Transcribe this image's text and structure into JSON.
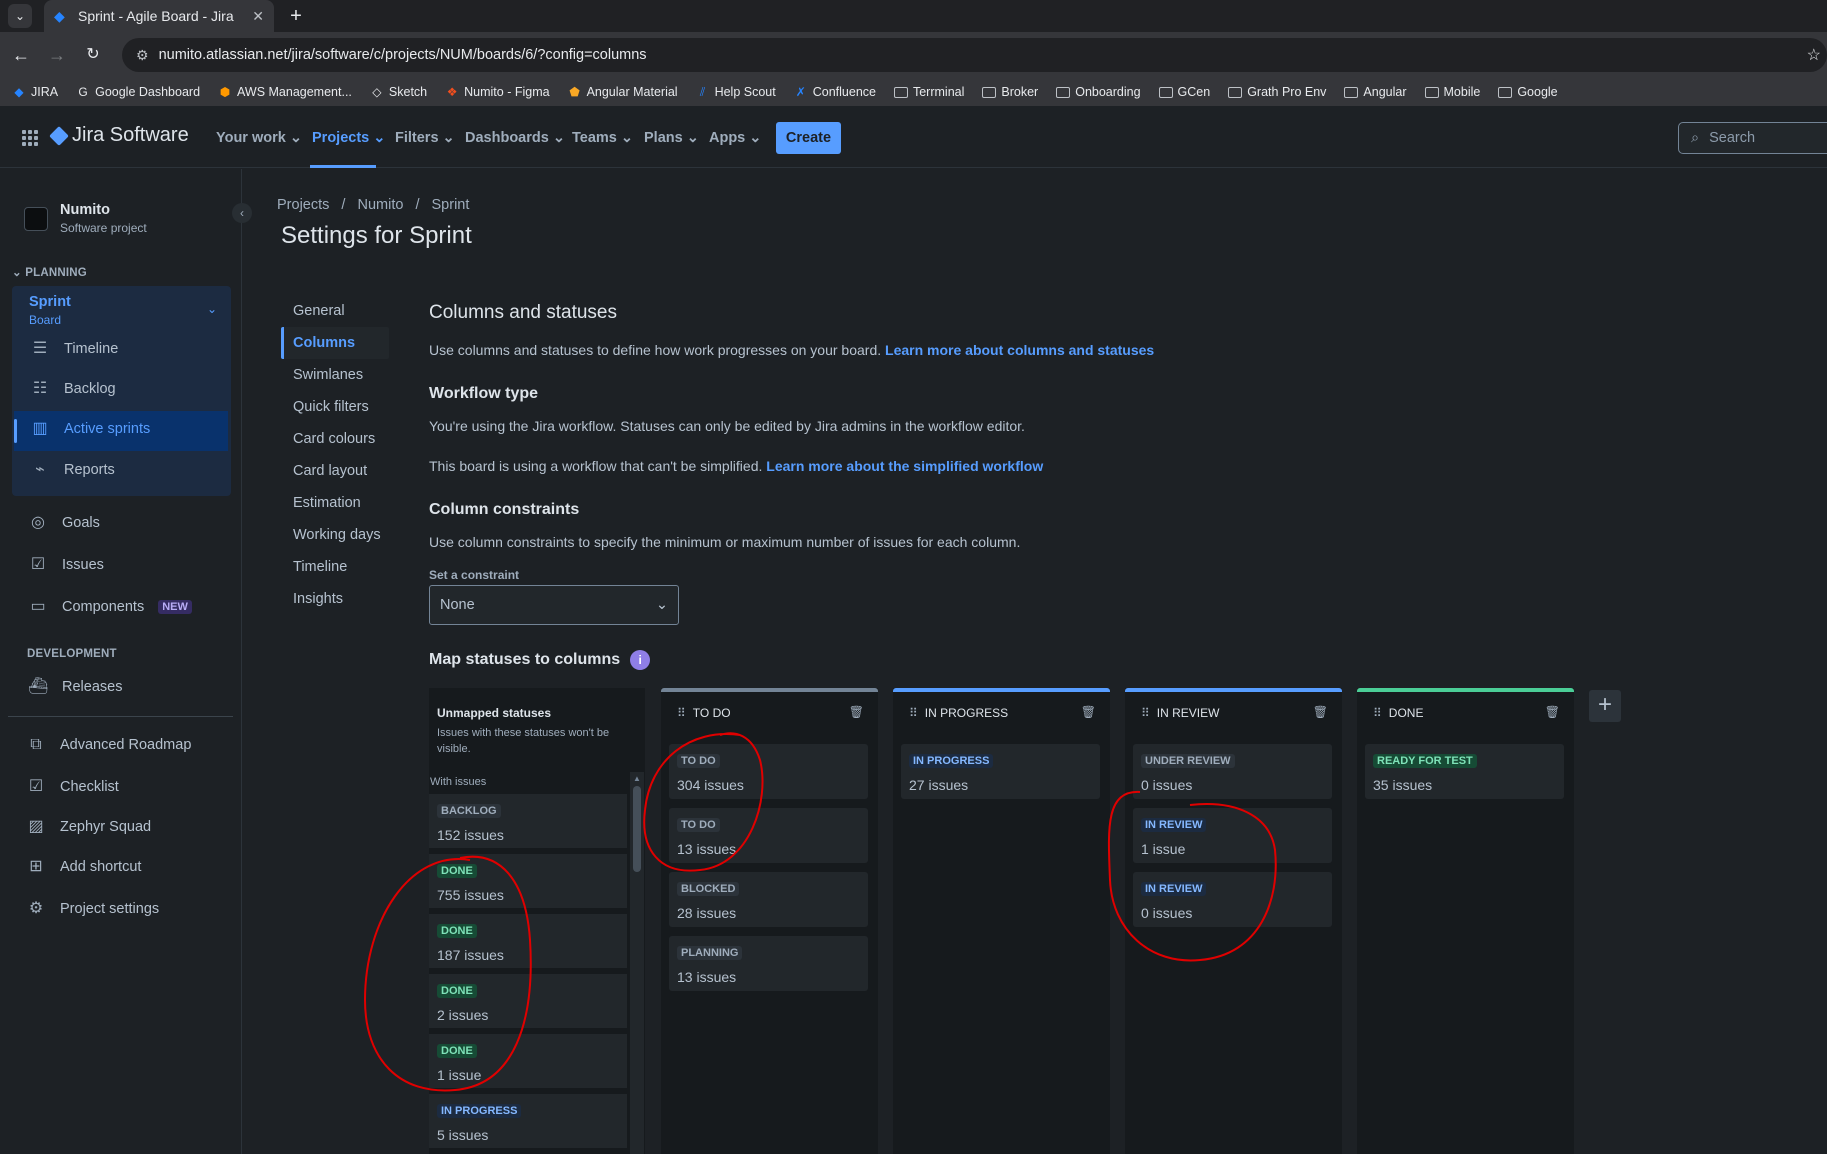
{
  "browser": {
    "tab_title": "Sprint - Agile Board - Jira",
    "url": "numito.atlassian.net/jira/software/c/projects/NUM/boards/6/?config=columns",
    "bookmarks": [
      "JIRA",
      "Google Dashboard",
      "AWS Management...",
      "Sketch",
      "Numito - Figma",
      "Angular Material",
      "Help Scout",
      "Confluence",
      "Terrminal",
      "Broker",
      "Onboarding",
      "GCen",
      "Grath Pro Env",
      "Angular",
      "Mobile",
      "Google"
    ]
  },
  "topnav": {
    "product": "Jira Software",
    "items": [
      "Your work",
      "Projects",
      "Filters",
      "Dashboards",
      "Teams",
      "Plans",
      "Apps"
    ],
    "create": "Create",
    "search_placeholder": "Search"
  },
  "sidebar": {
    "project_name": "Numito",
    "project_type": "Software project",
    "planning_label": "PLANNING",
    "sprint_title": "Sprint",
    "sprint_sub": "Board",
    "sprint_items": [
      "Timeline",
      "Backlog",
      "Active sprints",
      "Reports"
    ],
    "items": [
      "Goals",
      "Issues",
      "Components"
    ],
    "new_badge": "NEW",
    "development_label": "DEVELOPMENT",
    "releases": "Releases",
    "bottom_items": [
      "Advanced Roadmap",
      "Checklist",
      "Zephyr Squad",
      "Add shortcut",
      "Project settings"
    ]
  },
  "main": {
    "breadcrumb": [
      "Projects",
      "Numito",
      "Sprint"
    ],
    "title": "Settings for Sprint",
    "settings_nav": [
      "General",
      "Columns",
      "Swimlanes",
      "Quick filters",
      "Card colours",
      "Card layout",
      "Estimation",
      "Working days",
      "Timeline",
      "Insights"
    ],
    "columns_heading": "Columns and statuses",
    "columns_desc": "Use columns and statuses to define how work progresses on your board.",
    "columns_link": "Learn more about columns and statuses",
    "workflow_heading": "Workflow type",
    "workflow_desc": "You're using the Jira workflow. Statuses can only be edited by Jira admins in the workflow editor.",
    "workflow_desc2": "This board is using a workflow that can't be simplified.",
    "workflow_link": "Learn more about the simplified workflow",
    "constraints_heading": "Column constraints",
    "constraints_desc": "Use column constraints to specify the minimum or maximum number of issues for each column.",
    "set_constraint_label": "Set a constraint",
    "constraint_value": "None",
    "map_heading": "Map statuses to columns"
  },
  "unmapped": {
    "title": "Unmapped statuses",
    "desc": "Issues with these statuses won't be visible.",
    "with_issues": "With issues",
    "cards": [
      {
        "status": "BACKLOG",
        "count": "152 issues",
        "tone": "grey"
      },
      {
        "status": "DONE",
        "count": "755 issues",
        "tone": "green"
      },
      {
        "status": "DONE",
        "count": "187 issues",
        "tone": "green"
      },
      {
        "status": "DONE",
        "count": "2 issues",
        "tone": "green"
      },
      {
        "status": "DONE",
        "count": "1 issue",
        "tone": "green"
      },
      {
        "status": "IN PROGRESS",
        "count": "5 issues",
        "tone": "blue"
      }
    ]
  },
  "columns": [
    {
      "name": "TO DO",
      "accent": "#738496",
      "cards": [
        {
          "status": "TO DO",
          "count": "304 issues",
          "tone": "grey"
        },
        {
          "status": "TO DO",
          "count": "13 issues",
          "tone": "grey"
        },
        {
          "status": "BLOCKED",
          "count": "28 issues",
          "tone": "grey"
        },
        {
          "status": "PLANNING",
          "count": "13 issues",
          "tone": "grey"
        }
      ]
    },
    {
      "name": "IN PROGRESS",
      "accent": "#579dff",
      "cards": [
        {
          "status": "IN PROGRESS",
          "count": "27 issues",
          "tone": "blue"
        }
      ]
    },
    {
      "name": "IN REVIEW",
      "accent": "#579dff",
      "cards": [
        {
          "status": "UNDER REVIEW",
          "count": "0 issues",
          "tone": "grey"
        },
        {
          "status": "IN REVIEW",
          "count": "1 issue",
          "tone": "blue"
        },
        {
          "status": "IN REVIEW",
          "count": "0 issues",
          "tone": "blue"
        }
      ]
    },
    {
      "name": "DONE",
      "accent": "#4bce97",
      "cards": [
        {
          "status": "READY FOR TEST",
          "count": "35 issues",
          "tone": "green"
        }
      ]
    }
  ],
  "colors": {
    "annotation": "#e00000",
    "accent": "#579dff"
  }
}
